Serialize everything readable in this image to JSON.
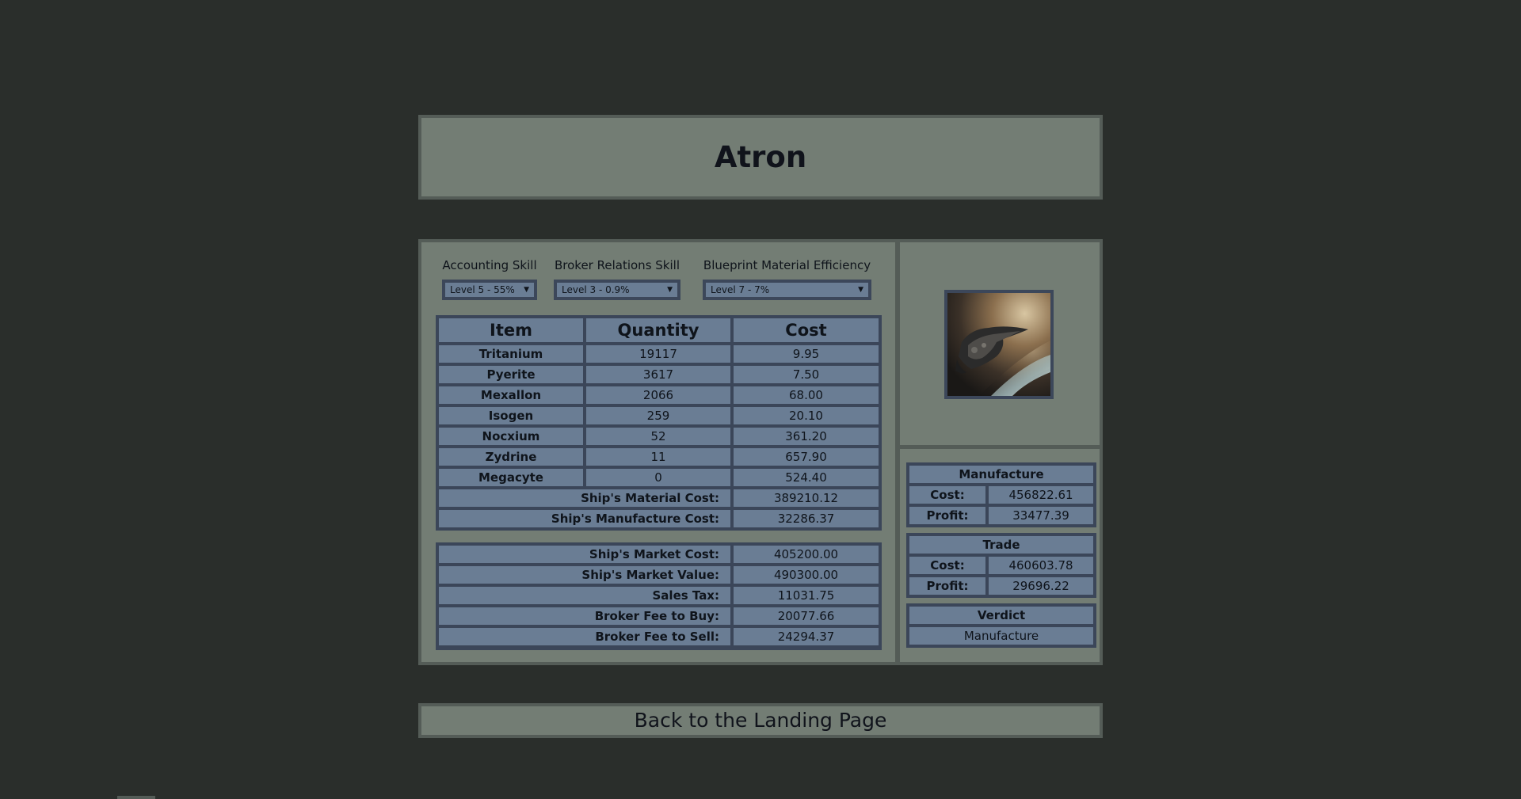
{
  "page": {
    "title": "Atron"
  },
  "skills": {
    "accounting": {
      "label": "Accounting Skill",
      "selected": "Level 5 - 55%"
    },
    "broker": {
      "label": "Broker Relations Skill",
      "selected": "Level 3 - 0.9%"
    },
    "blueprint": {
      "label": "Blueprint Material Efficiency",
      "selected": "Level 7 - 7%"
    }
  },
  "materials": {
    "headers": [
      "Item",
      "Quantity",
      "Cost"
    ],
    "rows": [
      {
        "item": "Tritanium",
        "quantity": "19117",
        "cost": "9.95"
      },
      {
        "item": "Pyerite",
        "quantity": "3617",
        "cost": "7.50"
      },
      {
        "item": "Mexallon",
        "quantity": "2066",
        "cost": "68.00"
      },
      {
        "item": "Isogen",
        "quantity": "259",
        "cost": "20.10"
      },
      {
        "item": "Nocxium",
        "quantity": "52",
        "cost": "361.20"
      },
      {
        "item": "Zydrine",
        "quantity": "11",
        "cost": "657.90"
      },
      {
        "item": "Megacyte",
        "quantity": "0",
        "cost": "524.40"
      }
    ],
    "summary": [
      {
        "label": "Ship's Material Cost:",
        "value": "389210.12"
      },
      {
        "label": "Ship's Manufacture Cost:",
        "value": "32286.37"
      }
    ]
  },
  "market": [
    {
      "label": "Ship's Market Cost:",
      "value": "405200.00"
    },
    {
      "label": "Ship's Market Value:",
      "value": "490300.00"
    },
    {
      "label": "Sales Tax:",
      "value": "11031.75"
    },
    {
      "label": "Broker Fee to Buy:",
      "value": "20077.66"
    },
    {
      "label": "Broker Fee to Sell:",
      "value": "24294.37"
    }
  ],
  "manufacture": {
    "title": "Manufacture",
    "cost_label": "Cost:",
    "cost": "456822.61",
    "profit_label": "Profit:",
    "profit": "33477.39"
  },
  "trade": {
    "title": "Trade",
    "cost_label": "Cost:",
    "cost": "460603.78",
    "profit_label": "Profit:",
    "profit": "29696.22"
  },
  "verdict": {
    "title": "Verdict",
    "value": "Manufacture"
  },
  "nav": {
    "back_label": "Back to the Landing Page"
  },
  "colors": {
    "background": "#2a2e2b",
    "panel": "#737d74",
    "cell": "#6a7d94",
    "border": "#3b4659"
  },
  "icons": {
    "dropdown": "triangle-down",
    "ship": "ship-image"
  }
}
